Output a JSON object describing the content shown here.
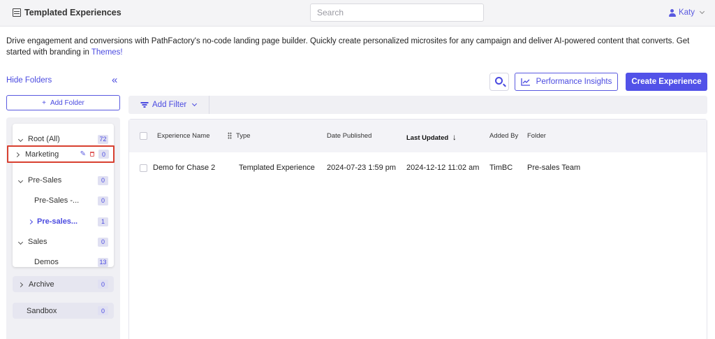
{
  "header": {
    "title": "Templated Experiences",
    "search_placeholder": "Search",
    "user_name": "Katy"
  },
  "intro": {
    "text": "Drive engagement and conversions with PathFactory's no-code landing page builder. Quickly create personalized microsites for any campaign and deliver AI-powered content that converts. Get started with branding in ",
    "link_text": "Themes!"
  },
  "sidebar": {
    "hide_label": "Hide Folders",
    "collapse_glyph": "«",
    "add_folder_label": "Add Folder",
    "tree": [
      {
        "label": "Root (All)",
        "count": "72"
      },
      {
        "label": "Marketing",
        "count": "0"
      },
      {
        "label": "Pre-Sales",
        "count": "0"
      },
      {
        "label": "Pre-Sales -...",
        "count": "0"
      },
      {
        "label": "Pre-sales...",
        "count": "1"
      },
      {
        "label": "Sales",
        "count": "0"
      },
      {
        "label": "Demos",
        "count": "13"
      }
    ],
    "archive": {
      "label": "Archive",
      "count": "0"
    },
    "sandbox": {
      "label": "Sandbox",
      "count": "0"
    }
  },
  "toolbar": {
    "performance_label": "Performance Insights",
    "create_label": "Create Experience",
    "filter_label": "Add Filter"
  },
  "table": {
    "columns": [
      "Experience Name",
      "Type",
      "Date Published",
      "Last Updated",
      "Added By",
      "Folder"
    ],
    "sort_glyph": "↓",
    "rows": [
      [
        "Demo for Chase 2",
        "Templated Experience",
        "2024-07-23 1:59 pm",
        "2024-12-12 11:02 am",
        "TimBC",
        "Pre-sales Team"
      ]
    ]
  },
  "colors": {
    "accent": "#5252e8",
    "highlight_border": "#d84030"
  }
}
